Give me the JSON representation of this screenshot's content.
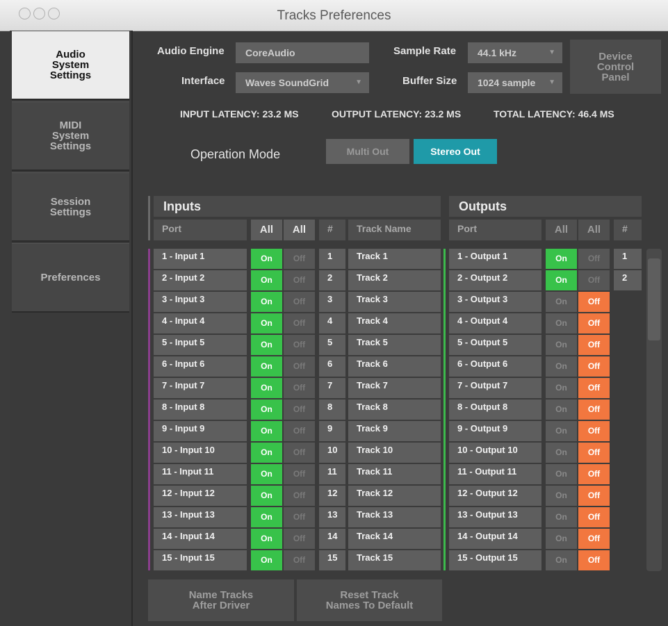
{
  "window": {
    "title": "Tracks Preferences"
  },
  "sidebar": {
    "tabs": [
      {
        "label": "Audio\nSystem\nSettings",
        "active": true
      },
      {
        "label": "MIDI\nSystem\nSettings",
        "active": false
      },
      {
        "label": "Session\nSettings",
        "active": false
      },
      {
        "label": "Preferences",
        "active": false
      }
    ]
  },
  "settings": {
    "audio_engine_label": "Audio Engine",
    "audio_engine_value": "CoreAudio",
    "interface_label": "Interface",
    "interface_value": "Waves SoundGrid",
    "sample_rate_label": "Sample Rate",
    "sample_rate_value": "44.1 kHz",
    "buffer_size_label": "Buffer Size",
    "buffer_size_value": "1024 sample",
    "device_control_panel": "Device\nControl\nPanel",
    "dropdown_arrow": "▼"
  },
  "latency": {
    "input": "INPUT LATENCY: 23.2 MS",
    "output": "OUTPUT LATENCY: 23.2 MS",
    "total": "TOTAL LATENCY: 46.4 MS"
  },
  "operation_mode": {
    "label": "Operation Mode",
    "options": [
      "Multi Out",
      "Stereo Out"
    ],
    "selected": "Stereo Out"
  },
  "inputs": {
    "title": "Inputs",
    "port_header": "Port",
    "all_on_header": "All",
    "all_off_header": "All",
    "number_header": "#",
    "track_name_header": "Track Name",
    "on_label": "On",
    "off_label": "Off",
    "rows": [
      {
        "port": "1 - Input 1",
        "state": "on",
        "number": "1",
        "track": "Track  1"
      },
      {
        "port": "2 - Input 2",
        "state": "on",
        "number": "2",
        "track": "Track  2"
      },
      {
        "port": "3 - Input 3",
        "state": "on",
        "number": "3",
        "track": "Track  3"
      },
      {
        "port": "4 - Input 4",
        "state": "on",
        "number": "4",
        "track": "Track  4"
      },
      {
        "port": "5 - Input 5",
        "state": "on",
        "number": "5",
        "track": "Track  5"
      },
      {
        "port": "6 - Input 6",
        "state": "on",
        "number": "6",
        "track": "Track  6"
      },
      {
        "port": "7 - Input 7",
        "state": "on",
        "number": "7",
        "track": "Track  7"
      },
      {
        "port": "8 - Input 8",
        "state": "on",
        "number": "8",
        "track": "Track  8"
      },
      {
        "port": "9 - Input 9",
        "state": "on",
        "number": "9",
        "track": "Track  9"
      },
      {
        "port": "10 - Input 10",
        "state": "on",
        "number": "10",
        "track": "Track  10"
      },
      {
        "port": "11 - Input 11",
        "state": "on",
        "number": "11",
        "track": "Track  11"
      },
      {
        "port": "12 - Input 12",
        "state": "on",
        "number": "12",
        "track": "Track  12"
      },
      {
        "port": "13 - Input 13",
        "state": "on",
        "number": "13",
        "track": "Track  13"
      },
      {
        "port": "14 - Input 14",
        "state": "on",
        "number": "14",
        "track": "Track  14"
      },
      {
        "port": "15 - Input 15",
        "state": "on",
        "number": "15",
        "track": "Track  15"
      }
    ]
  },
  "outputs": {
    "title": "Outputs",
    "port_header": "Port",
    "all_on_header": "All",
    "all_off_header": "All",
    "number_header": "#",
    "on_label": "On",
    "off_label": "Off",
    "rows": [
      {
        "port": "1 - Output 1",
        "state": "on",
        "number": "1"
      },
      {
        "port": "2 - Output 2",
        "state": "on",
        "number": "2"
      },
      {
        "port": "3 - Output 3",
        "state": "off"
      },
      {
        "port": "4 - Output 4",
        "state": "off"
      },
      {
        "port": "5 - Output 5",
        "state": "off"
      },
      {
        "port": "6 - Output 6",
        "state": "off"
      },
      {
        "port": "7 - Output 7",
        "state": "off"
      },
      {
        "port": "8 - Output 8",
        "state": "off"
      },
      {
        "port": "9 - Output 9",
        "state": "off"
      },
      {
        "port": "10 - Output 10",
        "state": "off"
      },
      {
        "port": "11 - Output 11",
        "state": "off"
      },
      {
        "port": "12 - Output 12",
        "state": "off"
      },
      {
        "port": "13 - Output 13",
        "state": "off"
      },
      {
        "port": "14 - Output 14",
        "state": "off"
      },
      {
        "port": "15 - Output 15",
        "state": "off"
      }
    ]
  },
  "buttons": {
    "name_tracks": "Name Tracks\nAfter Driver",
    "reset_names": "Reset Track\nNames To Default"
  },
  "colors": {
    "on_green": "#38c24a",
    "off_orange": "#f2773f",
    "stereo_out_teal": "#1f9aa8",
    "inputs_bar_purple": "#8a3e8c",
    "outputs_bar_green": "#3cba4c"
  }
}
